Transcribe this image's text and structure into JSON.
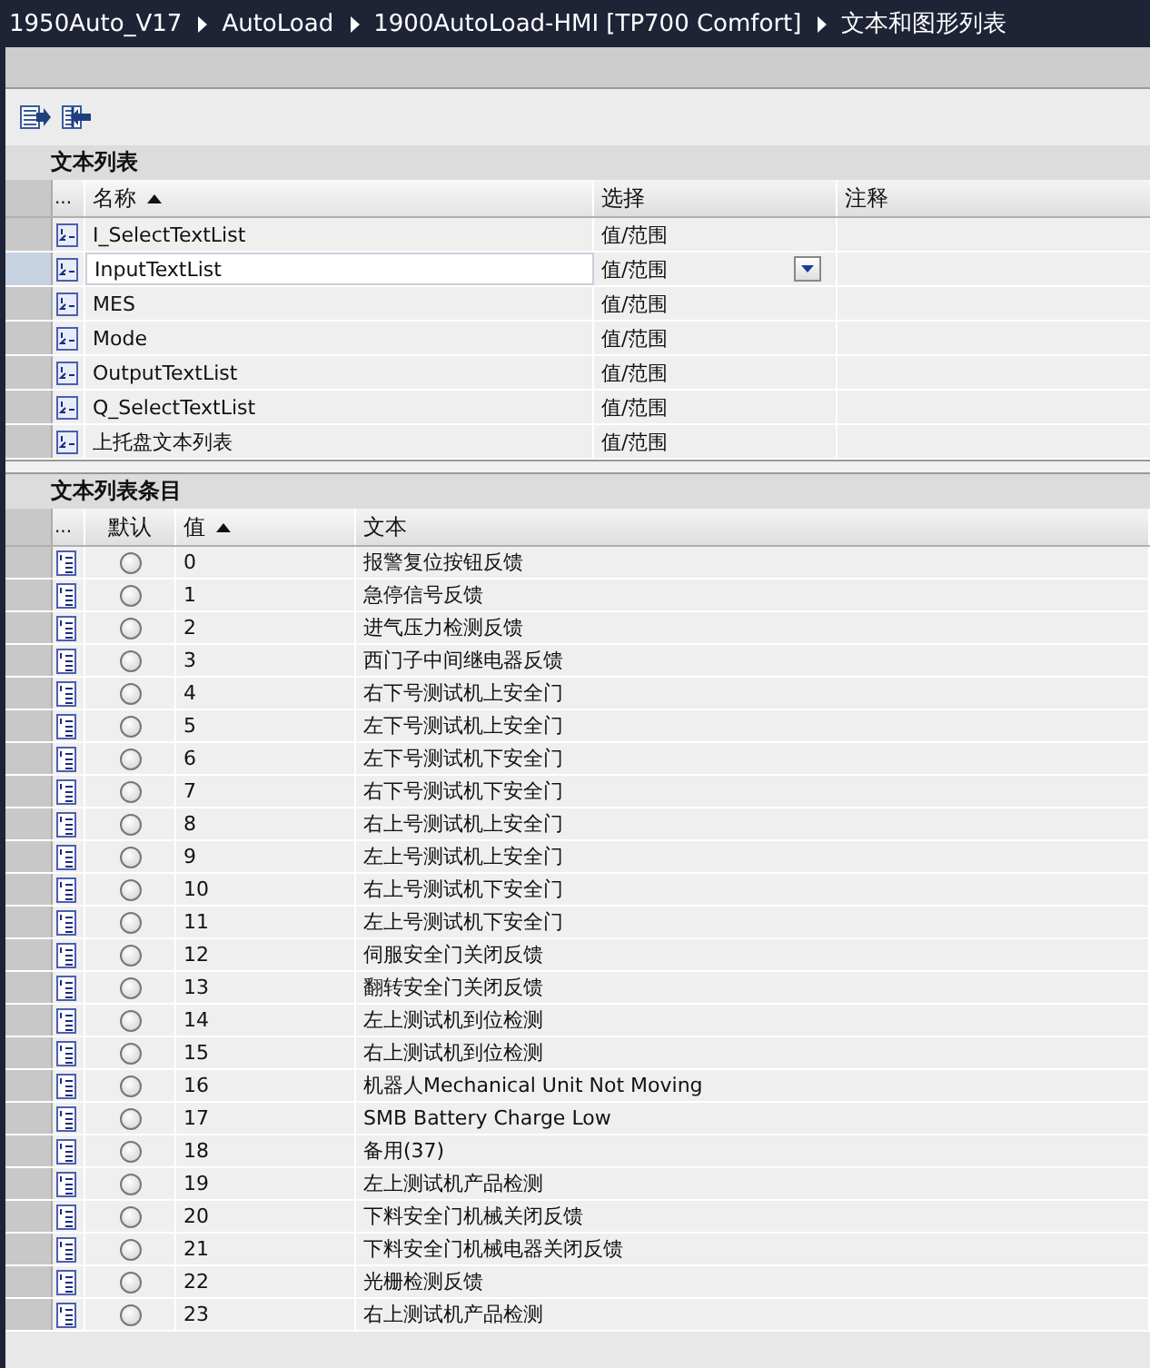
{
  "breadcrumb": [
    "1950Auto_V17",
    "AutoLoad",
    "1900AutoLoad-HMI [TP700 Comfort]",
    "文本和图形列表"
  ],
  "text_lists": {
    "title": "文本列表",
    "columns": [
      {
        "label": "...",
        "sorted": false
      },
      {
        "label": "名称",
        "sorted": true
      },
      {
        "label": "选择",
        "sorted": false
      },
      {
        "label": "注释",
        "sorted": false
      }
    ],
    "rows": [
      {
        "name": "I_SelectTextList",
        "selection": "值/范围",
        "selected": false
      },
      {
        "name": "InputTextList",
        "selection": "值/范围",
        "selected": true
      },
      {
        "name": "MES",
        "selection": "值/范围",
        "selected": false
      },
      {
        "name": "Mode",
        "selection": "值/范围",
        "selected": false
      },
      {
        "name": "OutputTextList",
        "selection": "值/范围",
        "selected": false
      },
      {
        "name": "Q_SelectTextList",
        "selection": "值/范围",
        "selected": false
      },
      {
        "name": "上托盘文本列表",
        "selection": "值/范围",
        "selected": false
      }
    ]
  },
  "entries": {
    "title": "文本列表条目",
    "columns": [
      {
        "label": "...",
        "sorted": false
      },
      {
        "label": "默认",
        "sorted": false
      },
      {
        "label": "值",
        "sorted": true
      },
      {
        "label": "文本",
        "sorted": false
      }
    ],
    "rows": [
      {
        "default": false,
        "value": "0",
        "text": "报警复位按钮反馈"
      },
      {
        "default": false,
        "value": "1",
        "text": "急停信号反馈"
      },
      {
        "default": false,
        "value": "2",
        "text": "进气压力检测反馈"
      },
      {
        "default": false,
        "value": "3",
        "text": "西门子中间继电器反馈"
      },
      {
        "default": false,
        "value": "4",
        "text": "右下号测试机上安全门"
      },
      {
        "default": false,
        "value": "5",
        "text": "左下号测试机上安全门"
      },
      {
        "default": false,
        "value": "6",
        "text": "左下号测试机下安全门"
      },
      {
        "default": false,
        "value": "7",
        "text": "右下号测试机下安全门"
      },
      {
        "default": false,
        "value": "8",
        "text": "右上号测试机上安全门"
      },
      {
        "default": false,
        "value": "9",
        "text": "左上号测试机上安全门"
      },
      {
        "default": false,
        "value": "10",
        "text": "右上号测试机下安全门"
      },
      {
        "default": false,
        "value": "11",
        "text": "左上号测试机下安全门"
      },
      {
        "default": false,
        "value": "12",
        "text": "伺服安全门关闭反馈"
      },
      {
        "default": false,
        "value": "13",
        "text": "翻转安全门关闭反馈"
      },
      {
        "default": false,
        "value": "14",
        "text": "左上测试机到位检测"
      },
      {
        "default": false,
        "value": "15",
        "text": "右上测试机到位检测"
      },
      {
        "default": false,
        "value": "16",
        "text": "机器人Mechanical Unit Not Moving"
      },
      {
        "default": false,
        "value": "17",
        "text": "SMB Battery Charge Low"
      },
      {
        "default": false,
        "value": "18",
        "text": "备用(37)"
      },
      {
        "default": false,
        "value": "19",
        "text": "左上测试机产品检测"
      },
      {
        "default": false,
        "value": "20",
        "text": "下料安全门机械关闭反馈"
      },
      {
        "default": false,
        "value": "21",
        "text": "下料安全门机械电器关闭反馈"
      },
      {
        "default": false,
        "value": "22",
        "text": "光栅检测反馈"
      },
      {
        "default": false,
        "value": "23",
        "text": "右上测试机产品检测"
      }
    ]
  }
}
